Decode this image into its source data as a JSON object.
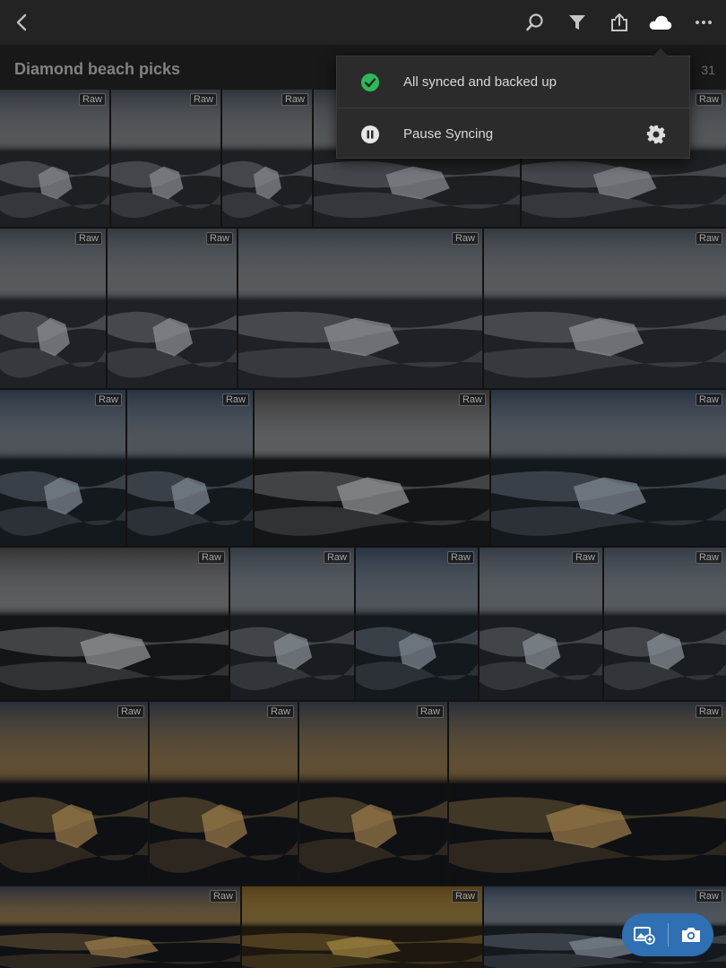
{
  "album": {
    "title": "Diamond beach picks",
    "count": "31"
  },
  "toolbar": {
    "icons": [
      "back-icon",
      "search-icon",
      "filter-icon",
      "share-icon",
      "cloud-icon",
      "more-icon"
    ]
  },
  "sync_menu": {
    "status_label": "All synced and backed up",
    "pause_label": "Pause Syncing"
  },
  "badge_label": "Raw",
  "rows": [
    {
      "photos": [
        {
          "tone": "a",
          "badge": true
        },
        {
          "tone": "a",
          "badge": true
        },
        {
          "tone": "a",
          "badge": true
        },
        {
          "tone": "a",
          "badge": false
        },
        {
          "tone": "a",
          "badge": true
        }
      ]
    },
    {
      "photos": [
        {
          "tone": "b",
          "badge": true
        },
        {
          "tone": "b",
          "badge": true
        },
        {
          "tone": "b",
          "badge": true
        },
        {
          "tone": "b",
          "badge": true
        }
      ]
    },
    {
      "photos": [
        {
          "tone": "c",
          "badge": true
        },
        {
          "tone": "c",
          "badge": true
        },
        {
          "tone": "d",
          "badge": true
        },
        {
          "tone": "c",
          "badge": true
        }
      ]
    },
    {
      "photos": [
        {
          "tone": "d",
          "badge": true
        },
        {
          "tone": "e",
          "badge": true
        },
        {
          "tone": "c",
          "badge": true
        },
        {
          "tone": "e",
          "badge": true
        },
        {
          "tone": "e",
          "badge": true
        }
      ]
    },
    {
      "photos": [
        {
          "tone": "f",
          "badge": true
        },
        {
          "tone": "f",
          "badge": true
        },
        {
          "tone": "f",
          "badge": true
        },
        {
          "tone": "f",
          "badge": true
        }
      ]
    },
    {
      "photos": [
        {
          "tone": "f",
          "badge": true
        },
        {
          "tone": "g",
          "badge": true
        },
        {
          "tone": "c",
          "badge": true
        }
      ]
    }
  ],
  "fab": {
    "icons": [
      "add-photo-icon",
      "camera-icon"
    ]
  },
  "colors": {
    "accent": "#2f6fb3",
    "synced": "#2fb85a"
  }
}
